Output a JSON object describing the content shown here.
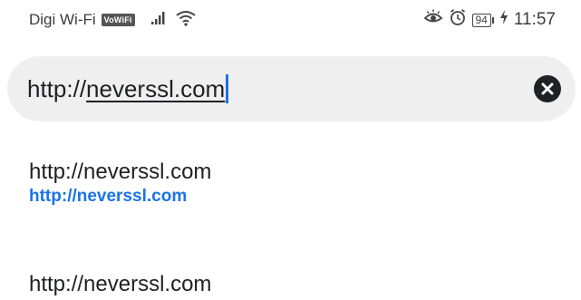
{
  "status_bar": {
    "carrier": "Digi Wi-Fi",
    "vowifi_badge": "VoWiFi",
    "signal_icon": "signal-bars-icon",
    "wifi_icon": "wifi-icon",
    "eye_icon": "eye-comfort-icon",
    "alarm_icon": "alarm-clock-icon",
    "battery_level": "94",
    "charging_icon": "charging-bolt-icon",
    "time": "11:57"
  },
  "address_bar": {
    "scheme": "http://",
    "domain": "neverssl.com",
    "clear_icon": "close-circle-icon"
  },
  "suggestions": [
    {
      "title": "http://neverssl.com",
      "url": "http://neverssl.com"
    },
    {
      "title": "http://neverssl.com"
    }
  ],
  "colors": {
    "address_bar_bg": "#efefef",
    "link_blue": "#1a73e8",
    "text_dark": "#202124"
  }
}
